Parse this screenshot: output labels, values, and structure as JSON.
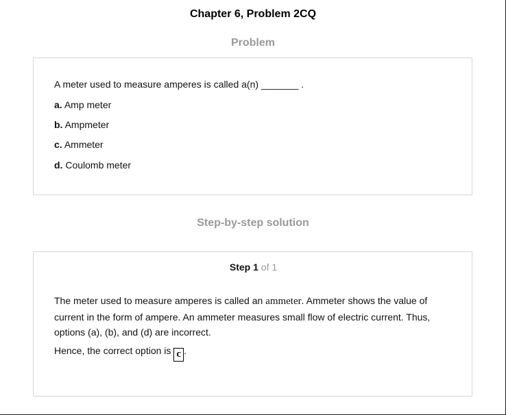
{
  "page": {
    "chapter_title": "Chapter 6, Problem 2CQ"
  },
  "problem": {
    "heading": "Problem",
    "question": "A meter used to measure amperes is called a(n) _______ .",
    "options": [
      {
        "letter": "a.",
        "text": "Amp meter"
      },
      {
        "letter": "b.",
        "text": "Ampmeter"
      },
      {
        "letter": "c.",
        "text": "Ammeter"
      },
      {
        "letter": "d.",
        "text": "Coulomb meter"
      }
    ]
  },
  "solution": {
    "heading": "Step-by-step solution",
    "step": {
      "word": "Step",
      "number": "1",
      "of_text": "of 1"
    },
    "explanation": {
      "before": "The meter used to measure amperes is called an ",
      "math_term": "ammeter",
      "after": ". Ammeter shows the value of current in the form of ampere. An ammeter measures small flow of electric current. Thus, options (a), (b), and (d) are incorrect."
    },
    "conclusion": {
      "text": "Hence, the correct option is ",
      "answer": "c",
      "period": "."
    }
  }
}
